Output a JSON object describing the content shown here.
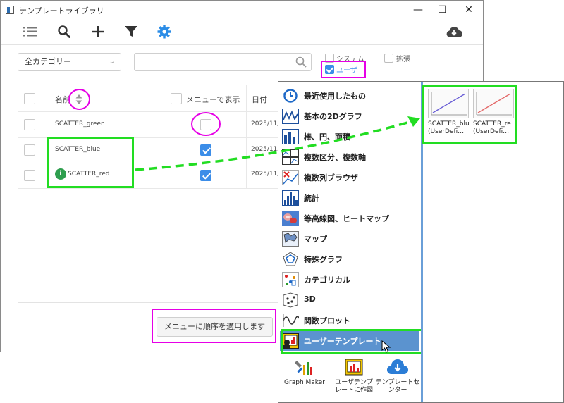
{
  "window": {
    "title": "テンプレートライブラリ",
    "controls": {
      "minimize": "—",
      "maximize": "☐",
      "close": "✕"
    }
  },
  "toolbar": {
    "icons": [
      "list-icon",
      "search-icon",
      "plus-icon",
      "filter-icon",
      "gear-icon",
      "cloud-download-icon"
    ],
    "accent": "#2b8ce6"
  },
  "filters": {
    "category_value": "全カテゴリー",
    "search_value": "",
    "checks": [
      {
        "label": "システム",
        "checked": false
      },
      {
        "label": "拡張",
        "checked": false
      },
      {
        "label": "ユーザ",
        "checked": true
      }
    ]
  },
  "table": {
    "columns": [
      "名前",
      "メニューで表示",
      "日付"
    ],
    "rows": [
      {
        "name": "SCATTER_green",
        "show_in_menu": false,
        "date": "2025/11/…"
      },
      {
        "name": "SCATTER_blue",
        "show_in_menu": true,
        "date": "2025/11/…"
      },
      {
        "name": "SCATTER_red",
        "show_in_menu": true,
        "date": "2025/11/…",
        "info_icon": "i"
      }
    ]
  },
  "apply_button": "メニューに順序を適用します",
  "popup": {
    "menu": [
      "最近使用したもの",
      "基本の2Dグラフ",
      "棒、円、面積",
      "複数区分、複数軸",
      "複数列ブラウザ",
      "統計",
      "等高線図、ヒートマップ",
      "マップ",
      "特殊グラフ",
      "カテゴリカル",
      "3D",
      "関数プロット",
      "ユーザーテンプレート"
    ],
    "active_index": 12,
    "bottom": [
      {
        "label": "Graph Maker"
      },
      {
        "label1": "ユーザテンプ",
        "label2": "レートに作図"
      },
      {
        "label1": "テンプレートセ",
        "label2": "ンター"
      }
    ],
    "thumbnails": [
      {
        "line1": "SCATTER_blu",
        "line2": "(UserDefi…",
        "color": "#6a5fd6"
      },
      {
        "line1": "SCATTER_re",
        "line2": "(UserDefi…",
        "color": "#e46a6a"
      }
    ]
  },
  "colors": {
    "annotation_magenta": "#e600e6",
    "annotation_green": "#22dd22",
    "menu_active": "#5b93cf"
  }
}
